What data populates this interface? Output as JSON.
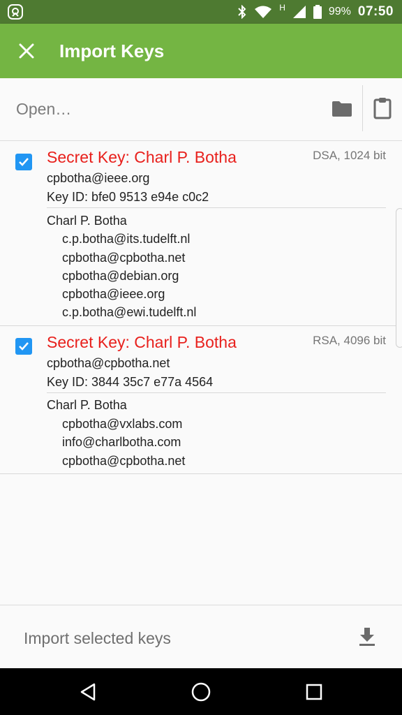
{
  "status_bar": {
    "network_type": "H",
    "battery": "99%",
    "time": "07:50"
  },
  "app_bar": {
    "title": "Import Keys"
  },
  "open_row": {
    "placeholder": "Open…"
  },
  "keys": [
    {
      "checked": true,
      "title": "Secret Key: Charl P. Botha",
      "algorithm": "DSA, 1024 bit",
      "email": "cpbotha@ieee.org",
      "key_id": "Key ID: bfe0 9513 e94e c0c2",
      "name": "Charl P. Botha",
      "user_ids": [
        "c.p.botha@its.tudelft.nl",
        "cpbotha@cpbotha.net",
        "cpbotha@debian.org",
        "cpbotha@ieee.org",
        "c.p.botha@ewi.tudelft.nl"
      ]
    },
    {
      "checked": true,
      "title": "Secret Key: Charl P. Botha",
      "algorithm": "RSA, 4096 bit",
      "email": "cpbotha@cpbotha.net",
      "key_id": "Key ID: 3844 35c7 e77a 4564",
      "name": "Charl P. Botha",
      "user_ids": [
        "cpbotha@vxlabs.com",
        "info@charlbotha.com",
        "cpbotha@cpbotha.net"
      ]
    }
  ],
  "bottom_action": {
    "label": "Import selected keys"
  },
  "colors": {
    "app_bar": "#74b543",
    "status_bar": "#4e7a31",
    "key_title": "#e8201c",
    "checkbox": "#2196f3"
  }
}
